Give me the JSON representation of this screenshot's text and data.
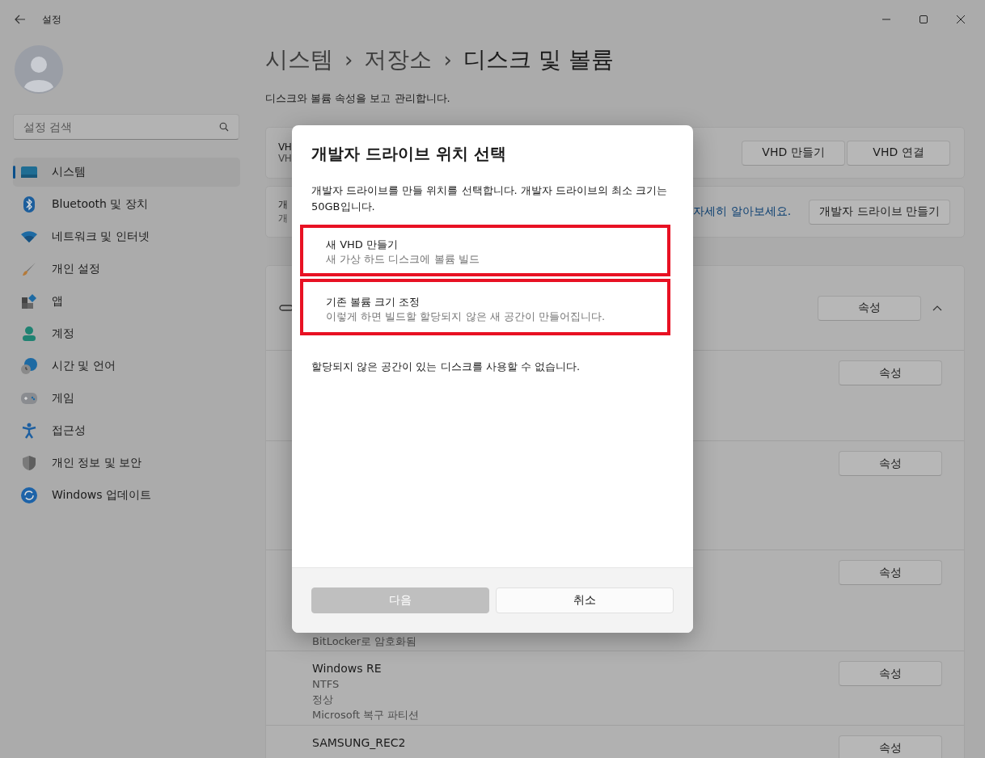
{
  "window": {
    "title": "설정"
  },
  "sidebar": {
    "search": {
      "placeholder": "설정 검색"
    },
    "items": [
      {
        "label": "시스템",
        "selected": true
      },
      {
        "label": "Bluetooth 및 장치",
        "selected": false
      },
      {
        "label": "네트워크 및 인터넷",
        "selected": false
      },
      {
        "label": "개인 설정",
        "selected": false
      },
      {
        "label": "앱",
        "selected": false
      },
      {
        "label": "계정",
        "selected": false
      },
      {
        "label": "시간 및 언어",
        "selected": false
      },
      {
        "label": "게임",
        "selected": false
      },
      {
        "label": "접근성",
        "selected": false
      },
      {
        "label": "개인 정보 및 보안",
        "selected": false
      },
      {
        "label": "Windows 업데이트",
        "selected": false
      }
    ]
  },
  "breadcrumb": [
    "시스템",
    "저장소",
    "디스크 및 볼륨"
  ],
  "breadcrumb_separator": "›",
  "subtitle": "디스크와 볼륨 속성을 보고 관리합니다.",
  "cards": [
    {
      "lines": [
        "VH",
        "VH"
      ],
      "buttons": [
        "VHD 만들기",
        "VHD 연결"
      ]
    },
    {
      "lines": [
        "개",
        "개"
      ],
      "link": "자세히 알아보세요.",
      "buttons": [
        "개발자 드라이브 만들기"
      ]
    }
  ],
  "disk": {
    "expanded": true,
    "button": "속성",
    "rows": [
      {
        "lines": [],
        "button": "속성"
      },
      {
        "lines": [],
        "button": "속성"
      },
      {
        "lines": [
          "BitLocker로 암호화됨"
        ],
        "button": "속성"
      },
      {
        "lines": [
          "Windows RE",
          "NTFS",
          "정상",
          "Microsoft 복구 파티션"
        ],
        "button": "속성"
      },
      {
        "lines": [
          "SAMSUNG_REC2"
        ],
        "button": "속성"
      }
    ]
  },
  "dialog": {
    "title": "개발자 드라이브 위치 선택",
    "description": "개발자 드라이브를 만들 위치를 선택합니다. 개발자 드라이브의 최소 크기는 50GB입니다.",
    "options": [
      {
        "title": "새 VHD 만들기",
        "subtitle": "새 가상 하드 디스크에 볼륨 빌드",
        "highlighted": true
      },
      {
        "title": "기존 볼륨 크기 조정",
        "subtitle": "이렇게 하면 빌드할 할당되지 않은 새 공간이 만들어집니다.",
        "highlighted": true
      }
    ],
    "note": "할당되지 않은 공간이 있는 디스크를 사용할 수 없습니다.",
    "buttons": [
      {
        "label": "다음",
        "disabled": true
      },
      {
        "label": "취소",
        "disabled": false
      }
    ]
  }
}
